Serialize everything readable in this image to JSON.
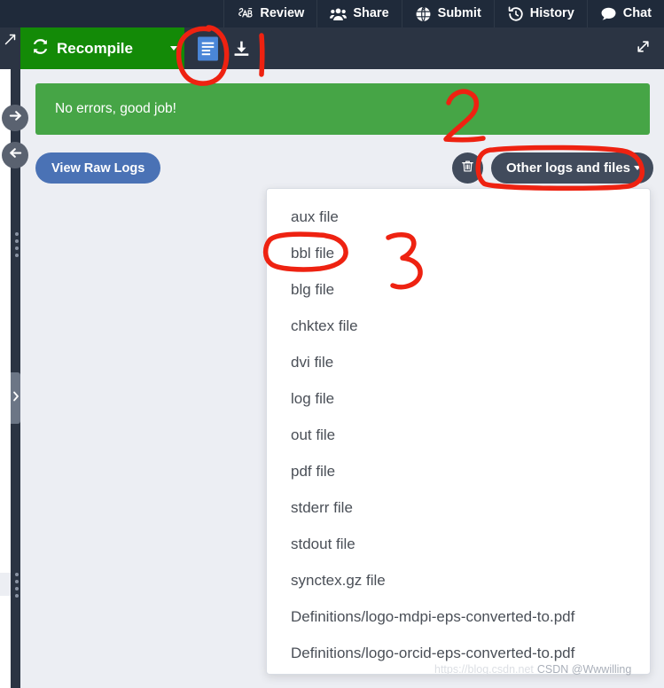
{
  "topnav": {
    "items": [
      {
        "label": "Review",
        "icon": "review-pen-icon"
      },
      {
        "label": "Share",
        "icon": "share-people-icon"
      },
      {
        "label": "Submit",
        "icon": "submit-globe-icon"
      },
      {
        "label": "History",
        "icon": "history-clock-icon"
      },
      {
        "label": "Chat",
        "icon": "chat-bubble-icon"
      }
    ]
  },
  "toolbar": {
    "recompile_label": "Recompile",
    "recompile_icon": "refresh-icon",
    "recompile_caret_icon": "caret-down-icon",
    "pdf_icon": "pdf-file-icon",
    "download_icon": "download-icon",
    "expand_left_icon": "expand-arrow-icon",
    "expand_right_icon": "expand-arrow-icon",
    "recompile_color": "#138a07"
  },
  "rail": {
    "forward_icon": "arrow-right-circle-icon",
    "back_icon": "arrow-left-circle-icon",
    "edge_chevron_icon": "chevron-right-icon",
    "drag_handle_icon": "drag-dots-icon"
  },
  "log_panel": {
    "alert_text": "No errors, good job!",
    "alert_color": "#46a546",
    "raw_logs_label": "View Raw Logs",
    "raw_logs_color": "#4a72b5",
    "trash_icon": "trash-icon",
    "other_logs_label": "Other logs and files",
    "other_logs_caret_icon": "caret-down-icon",
    "other_logs_color": "#414b5c"
  },
  "dropdown": {
    "items": [
      {
        "label": "aux file"
      },
      {
        "label": "bbl file"
      },
      {
        "label": "blg file"
      },
      {
        "label": "chktex file"
      },
      {
        "label": "dvi file"
      },
      {
        "label": "log file"
      },
      {
        "label": "out file"
      },
      {
        "label": "pdf file"
      },
      {
        "label": "stderr file"
      },
      {
        "label": "stdout file"
      },
      {
        "label": "synctex.gz file"
      },
      {
        "label": "Definitions/logo-mdpi-eps-converted-to.pdf"
      },
      {
        "label": "Definitions/logo-orcid-eps-converted-to.pdf"
      }
    ]
  },
  "annotations": {
    "color": "#ee2211",
    "marks": [
      {
        "name": "circle-around-pdf-icon",
        "kind": "ellipse"
      },
      {
        "name": "vertical-stroke",
        "kind": "line"
      },
      {
        "name": "numeral-2",
        "kind": "digit",
        "text": "2"
      },
      {
        "name": "circle-around-other-logs",
        "kind": "ellipse"
      },
      {
        "name": "circle-around-bbl-file",
        "kind": "ellipse"
      },
      {
        "name": "numeral-3",
        "kind": "digit",
        "text": "3"
      }
    ]
  },
  "watermark": {
    "url": "https://blog.csdn.net",
    "user": "CSDN @Wwwilling"
  }
}
